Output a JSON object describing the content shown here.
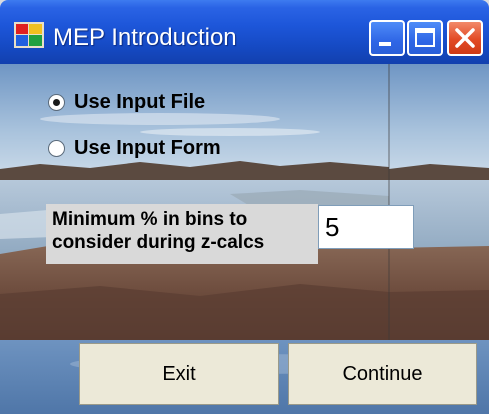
{
  "window": {
    "title": "MEP Introduction",
    "controls": [
      "minimize",
      "maximize",
      "close"
    ]
  },
  "options": {
    "use_input_file": {
      "label": "Use Input File",
      "selected": true
    },
    "use_input_form": {
      "label": "Use Input Form",
      "selected": false
    }
  },
  "min_bins": {
    "label": "Minimum % in bins to consider during z-calcs",
    "value": "5"
  },
  "buttons": {
    "exit": "Exit",
    "continue": "Continue"
  },
  "colors": {
    "titlebar": "#1d56d9",
    "close_button": "#e24a25",
    "button_face": "#ece9d8"
  }
}
